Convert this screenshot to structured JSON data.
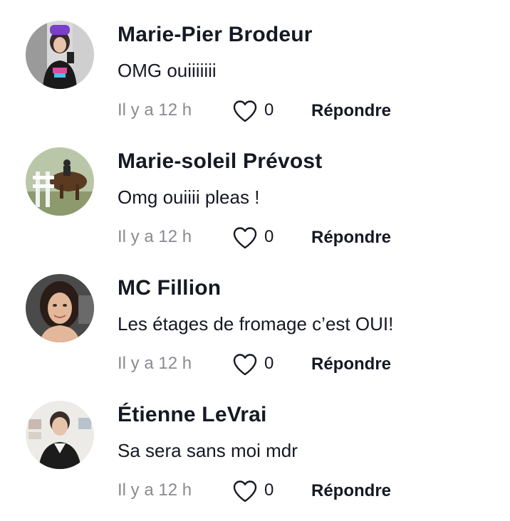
{
  "comments": [
    {
      "username": "Marie-Pier Brodeur",
      "text": "OMG ouiiiiiii",
      "time": "Il y a 12 h",
      "likes": "0",
      "reply_label": "Répondre",
      "avatar_icon": "avatar-photo"
    },
    {
      "username": "Marie-soleil Prévost",
      "text": "Omg ouiiii pleas !",
      "time": "Il y a 12 h",
      "likes": "0",
      "reply_label": "Répondre",
      "avatar_icon": "avatar-photo"
    },
    {
      "username": "MC Fillion",
      "text": "Les étages de fromage c’est OUI!",
      "time": "Il y a 12 h",
      "likes": "0",
      "reply_label": "Répondre",
      "avatar_icon": "avatar-photo"
    },
    {
      "username": "Étienne LeVrai",
      "text": "Sa sera sans moi mdr",
      "time": "Il y a 12 h",
      "likes": "0",
      "reply_label": "Répondre",
      "avatar_icon": "avatar-photo"
    }
  ],
  "colors": {
    "text": "#161823",
    "muted": "#8a8b91",
    "heart_outline": "#161823"
  }
}
